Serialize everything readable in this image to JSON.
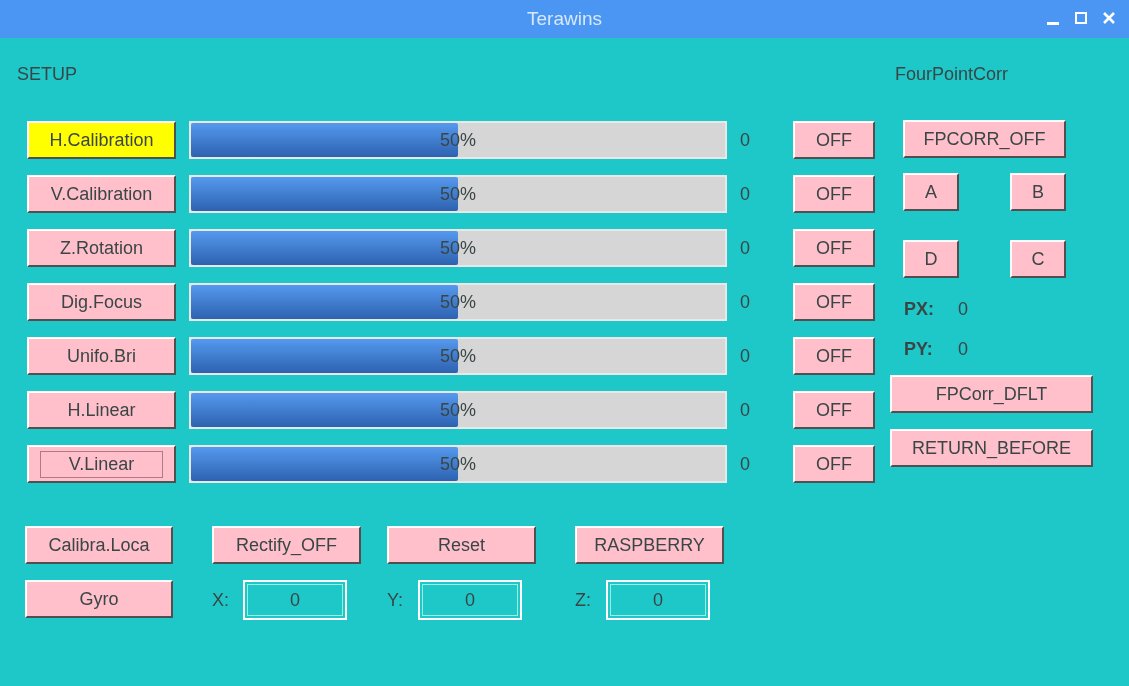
{
  "window": {
    "title": "Terawins"
  },
  "setup": {
    "heading": "SETUP",
    "rows": [
      {
        "label": "H.Calibration",
        "selected": true,
        "focused": false,
        "level": 0.5,
        "percent": "50%",
        "value": "0",
        "toggle": "OFF"
      },
      {
        "label": "V.Calibration",
        "selected": false,
        "focused": false,
        "level": 0.5,
        "percent": "50%",
        "value": "0",
        "toggle": "OFF"
      },
      {
        "label": "Z.Rotation",
        "selected": false,
        "focused": false,
        "level": 0.5,
        "percent": "50%",
        "value": "0",
        "toggle": "OFF"
      },
      {
        "label": "Dig.Focus",
        "selected": false,
        "focused": false,
        "level": 0.5,
        "percent": "50%",
        "value": "0",
        "toggle": "OFF"
      },
      {
        "label": "Unifo.Bri",
        "selected": false,
        "focused": false,
        "level": 0.5,
        "percent": "50%",
        "value": "0",
        "toggle": "OFF"
      },
      {
        "label": "H.Linear",
        "selected": false,
        "focused": false,
        "level": 0.5,
        "percent": "50%",
        "value": "0",
        "toggle": "OFF"
      },
      {
        "label": "V.Linear",
        "selected": false,
        "focused": true,
        "level": 0.5,
        "percent": "50%",
        "value": "0",
        "toggle": "OFF"
      }
    ]
  },
  "bottom": {
    "buttons": [
      "Calibra.Loca",
      "Rectify_OFF",
      "Reset",
      "RASPBERRY"
    ],
    "gyro_button": "Gyro",
    "fields": [
      {
        "label": "X:",
        "value": "0"
      },
      {
        "label": "Y:",
        "value": "0"
      },
      {
        "label": "Z:",
        "value": "0"
      }
    ]
  },
  "four_point_corr": {
    "heading": "FourPointCorr",
    "toggle": "FPCORR_OFF",
    "points_top": [
      "A",
      "B"
    ],
    "points_bottom": [
      "D",
      "C"
    ],
    "readouts": [
      {
        "label": "PX:",
        "value": "0"
      },
      {
        "label": "PY:",
        "value": "0"
      }
    ],
    "buttons": [
      "FPCorr_DFLT",
      "RETURN_BEFORE"
    ]
  }
}
